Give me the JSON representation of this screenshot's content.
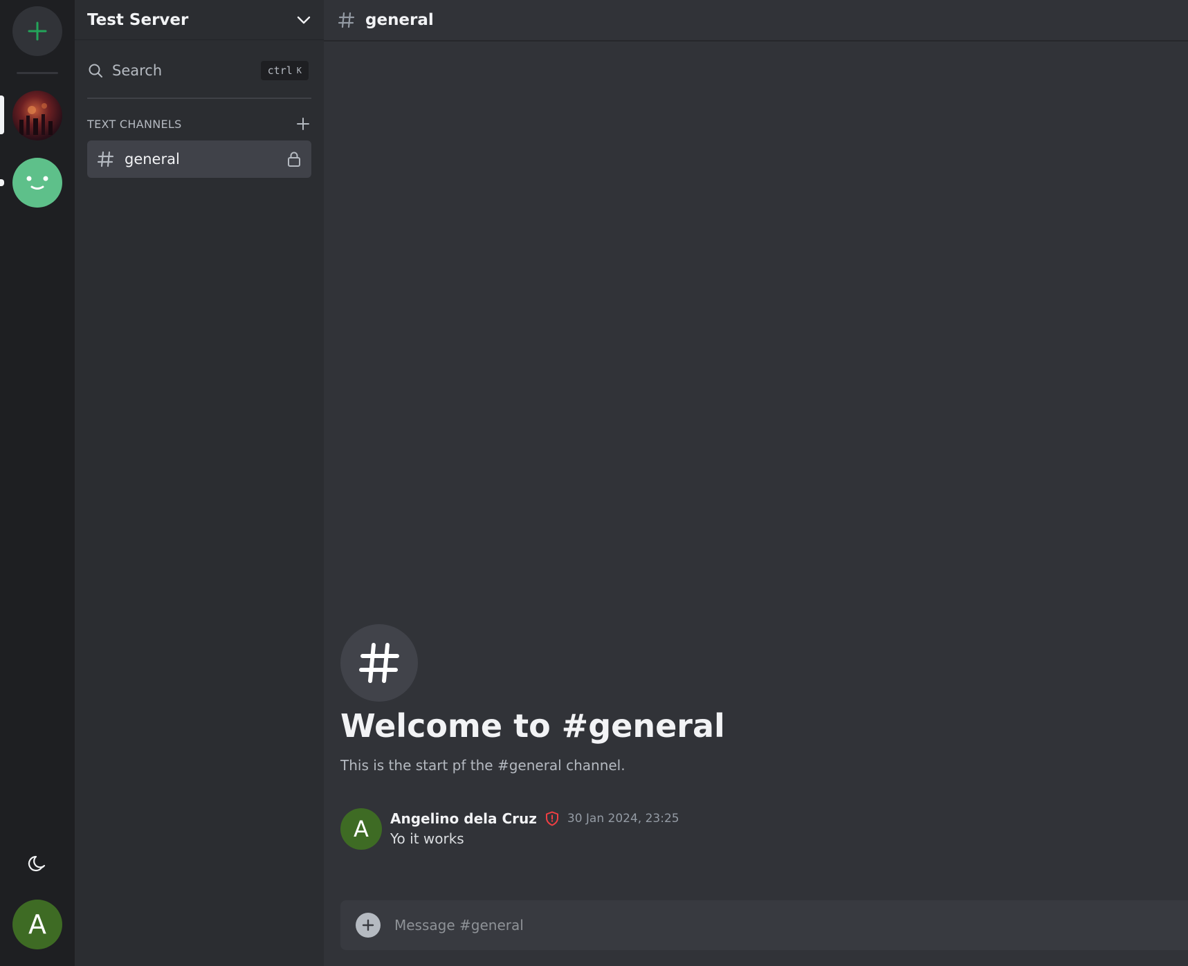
{
  "server": {
    "name": "Test Server",
    "search_label": "Search",
    "shortcut_ctrl": "ctrl",
    "shortcut_key": "K",
    "section_title": "TEXT CHANNELS",
    "channels": [
      {
        "name": "general",
        "locked": true,
        "active": true
      }
    ]
  },
  "rail": {
    "user_initial": "A",
    "icons": [
      "plus-icon",
      "moon-icon"
    ]
  },
  "main": {
    "channel_title": "general",
    "welcome_title": "Welcome to #general",
    "welcome_subtitle": "This is the start pf the #general channel.",
    "messages": [
      {
        "avatar_initial": "A",
        "author": "Angelino dela Cruz",
        "timestamp": "30 Jan 2024, 23:25",
        "text": "Yo it works"
      }
    ],
    "composer_placeholder": "Message #general"
  },
  "colors": {
    "accent_green": "#23a55a",
    "avatar_green": "#3e6b24",
    "badge_red": "#f23f43"
  }
}
